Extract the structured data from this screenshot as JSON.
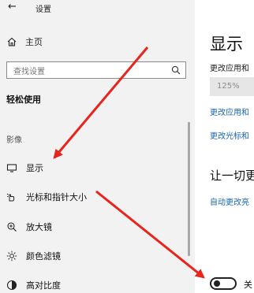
{
  "window": {
    "back_glyph": "←",
    "title": "设置"
  },
  "sidebar": {
    "home_label": "主页",
    "search_placeholder": "查找设置",
    "section_title": "轻松使用",
    "group_label": "影像",
    "items": [
      {
        "label": "显示",
        "icon": "monitor-icon"
      },
      {
        "label": "光标和指针大小",
        "icon": "pointer-icon"
      },
      {
        "label": "放大镜",
        "icon": "magnifier-icon"
      },
      {
        "label": "颜色滤镜",
        "icon": "sun-icon"
      },
      {
        "label": "高对比度",
        "icon": "contrast-icon"
      }
    ]
  },
  "main": {
    "title": "显示",
    "setting_label": "更改应用和",
    "scale_value": "125%",
    "link1": "更改应用和",
    "link2": "更改光标和",
    "subtitle": "让一切更",
    "link3": "自动更改亮",
    "toggle": {
      "state": "off",
      "label": "关"
    }
  },
  "colors": {
    "sidebar_bg": "#f2f2f2",
    "link": "#1a66b3",
    "arrow": "#e8251c"
  }
}
